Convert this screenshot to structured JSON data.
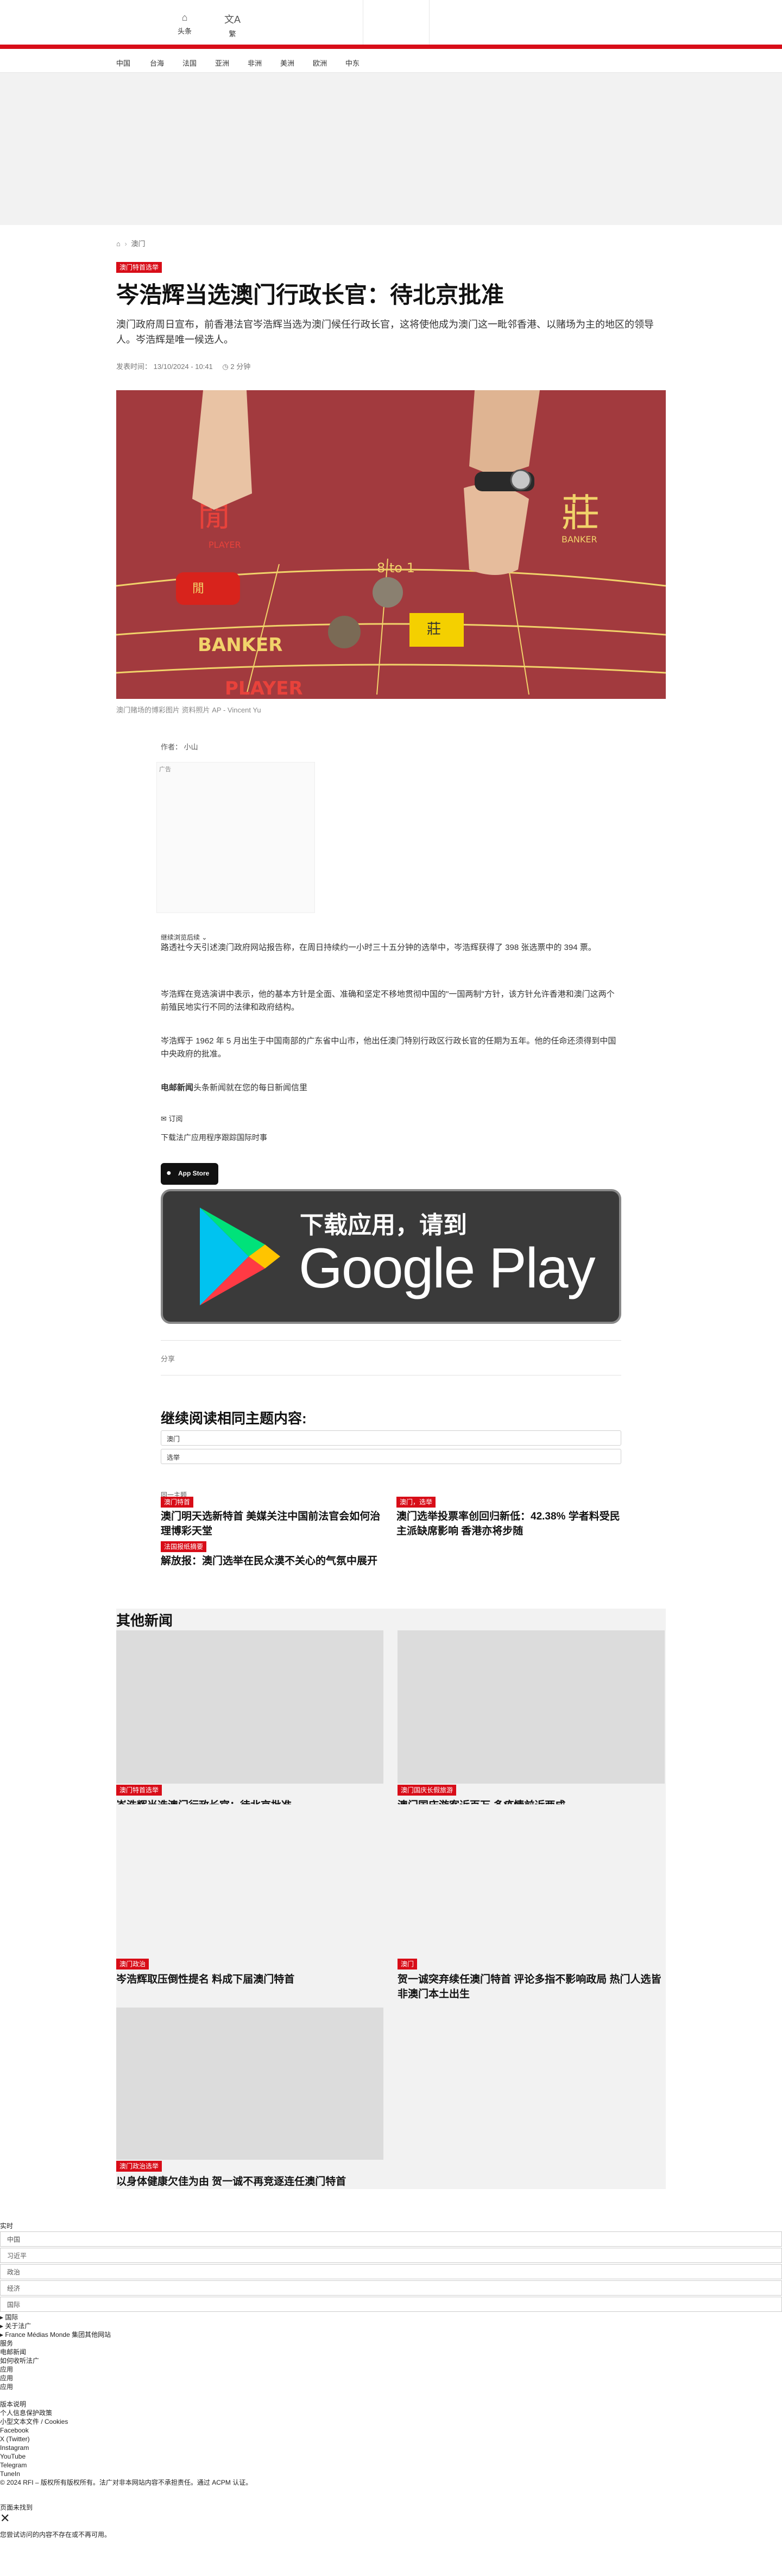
{
  "header": {
    "nav_icons": [
      {
        "icon": "home-icon",
        "label": "头条"
      },
      {
        "icon": "translate-icon",
        "label": "繁"
      }
    ]
  },
  "categories": [
    "中国",
    "台海",
    "法国",
    "亚洲",
    "非洲",
    "美洲",
    "欧洲",
    "中东"
  ],
  "breadcrumb": {
    "home_icon": "home-icon",
    "section": "澳门"
  },
  "article": {
    "tag": "澳门特首选举",
    "title": "岑浩辉当选澳门行政长官：待北京批准",
    "lead": "澳门政府周日宣布，前香港法官岑浩辉当选为澳门候任行政长官，这将使他成为澳门这一毗邻香港、以赌场为主的地区的领导人。岑浩辉是唯一候选人。",
    "meta": {
      "published_label": "发表时间：",
      "published": "13/10/2024 - 10:41",
      "read_icon": "clock-icon",
      "read_time": "2 分钟"
    },
    "image_caption": "澳门赌场的博彩图片 资料照片 AP - Vincent Yu",
    "author_label": "作者：",
    "author": "小山",
    "ad_label": "广告",
    "continue_reading": "继续浏览后续",
    "paragraphs": [
      "路透社今天引述澳门政府网站报告称，在周日持续约一小时三十五分钟的选举中，岑浩辉获得了 398 张选票中的 394 票。",
      "岑浩辉在竞选演讲中表示，他的基本方针是全面、准确和坚定不移地贯彻中国的\"一国两制\"方针，该方针允许香港和澳门这两个前殖民地实行不同的法律和政府结构。",
      "岑浩辉于 1962 年 5 月出生于中国南部的广东省中山市，他出任澳门特别行政区行政长官的任期为五年。他的任命还须得到中国中央政府的批准。"
    ],
    "newsletter_bold": "电邮新闻",
    "newsletter_text": "头条新闻就在您的每日新闻信里",
    "subscribe": "订阅",
    "app_promo": "下载法广应用程序跟踪国际时事",
    "appstore_label": "App Store",
    "gplay_line1": "下载应用，请到",
    "gplay_line2": "Google Play",
    "share": "分享"
  },
  "related": {
    "heading": "继续阅读相同主题内容:",
    "tags": [
      "澳门",
      "选举"
    ],
    "same_topic": "同一主题",
    "items": [
      {
        "tag": "澳门特首",
        "title": "澳门明天选新特首 美媒关注中国前法官会如何治理博彩天堂"
      },
      {
        "tag": "澳门，选举",
        "title": "澳门选举投票率创回归新低：42.38% 学者料受民主派缺席影响 香港亦将步随"
      },
      {
        "tag": "法国报纸摘要",
        "title": "解放报：澳门选举在民众漠不关心的气氛中展开"
      }
    ]
  },
  "others": {
    "heading": "其他新闻",
    "cards": [
      {
        "tag": "澳门特首选举",
        "title": "岑浩辉当选澳门行政长官：待北京批准"
      },
      {
        "tag": "澳门国庆长假旅游",
        "title": "澳门国庆游客近百万 多疫情前近两成"
      },
      {
        "tag": "澳门政治",
        "title": "岑浩辉取压倒性提名 料成下届澳门特首"
      },
      {
        "tag": "澳门",
        "title": "贺一诚突弃续任澳门特首 评论多指不影响政局 热门人选皆非澳门本土出生"
      },
      {
        "tag": "澳门政治选举",
        "title": "以身体健康欠佳为由 贺一诚不再竞逐连任澳门特首"
      }
    ]
  },
  "footer": {
    "live": "实时",
    "sections": [
      "中国",
      "习近平",
      "政治",
      "经济",
      "国际"
    ],
    "links": [
      "▸ 国际",
      "▸ 关于法广",
      "▸ France Médias Monde 集团其他网站",
      "服务",
      "电邮新闻",
      "如何收听法广",
      "应用",
      "应用",
      "应用",
      "版本说明",
      "个人信息保护政策",
      "小型文本文件 / Cookies",
      "Facebook",
      "X (Twitter)",
      "Instagram",
      "YouTube",
      "Telegram",
      "TuneIn",
      "© 2024 RFI – 版权所有版权所有。法广对非本网站内容不承担责任。通过 ACPM 认证。"
    ],
    "not_found": "页面未找到",
    "not_found_msg": "您尝试访问的内容不存在或不再可用。"
  }
}
